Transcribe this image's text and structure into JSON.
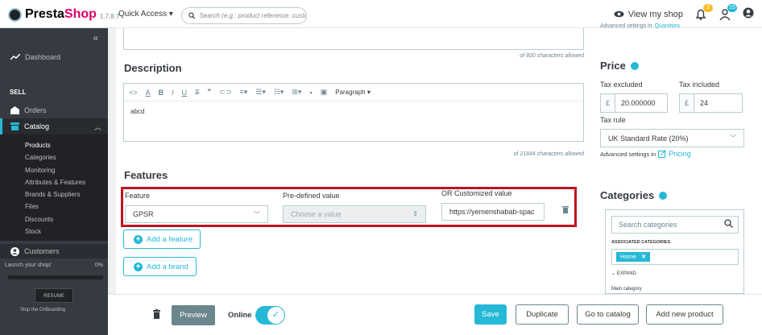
{
  "header": {
    "brand_presta": "Presta",
    "brand_shop": "Shop",
    "version": "1.7.8.7",
    "quick_access": "Quick Access ▾",
    "search_placeholder": "Search (e.g.: product reference, custon",
    "view_shop": "View my shop",
    "notif_count": "3",
    "msg_count": "15"
  },
  "sidebar": {
    "collapse": "«",
    "dashboard": "Dashboard",
    "sell": "SELL",
    "orders": "Orders",
    "catalog": "Catalog",
    "catalog_items": [
      "Products",
      "Categories",
      "Monitoring",
      "Attributes & Features",
      "Brands & Suppliers",
      "Files",
      "Discounts",
      "Stock"
    ],
    "customers": "Customers",
    "launch": "Launch your shop!",
    "launch_pct": "0%",
    "progress": 0,
    "resume": "RESUME",
    "stop": "Stop the OnBoarding"
  },
  "main": {
    "summary_hint": "of 800 characters allowed",
    "description_title": "Description",
    "paragraph": "Paragraph ▾",
    "description_text": "abcd",
    "description_hint": "of 21844 characters allowed",
    "features_title": "Features",
    "feature_label": "Feature",
    "feature_value": "GPSR",
    "predefined_label": "Pre-defined value",
    "predefined_placeholder": "Choose a value",
    "customized_label": "OR Customized value",
    "customized_value": "https://yemenshabab-spac",
    "add_feature": "Add a feature",
    "add_brand": "Add a brand"
  },
  "right": {
    "partial_top": "Advanced settings in",
    "partial_link": "Quantities",
    "price_title": "Price",
    "tax_excluded": "Tax excluded",
    "tax_included": "Tax included",
    "currency": "£",
    "price_excl": "20.000000",
    "price_incl": "24",
    "tax_rule_label": "Tax rule",
    "tax_rule": "UK Standard Rate (20%)",
    "advanced": "Advanced settings in",
    "pricing_link": "Pricing",
    "categories_title": "Categories",
    "search_categories": "Search categories",
    "associated": "ASSOCIATED CATEGORIES",
    "chip": "Home",
    "expand": "EXPAND",
    "main_category": "Main category"
  },
  "bottom": {
    "preview": "Preview",
    "online": "Online",
    "save": "Save",
    "duplicate": "Duplicate",
    "go_catalog": "Go to catalog",
    "add_new": "Add new product"
  },
  "colors": {
    "accent": "#25b9d7",
    "brand": "#df0067",
    "highlight_border": "#c1121f",
    "sidebar_bg": "#363a41"
  }
}
